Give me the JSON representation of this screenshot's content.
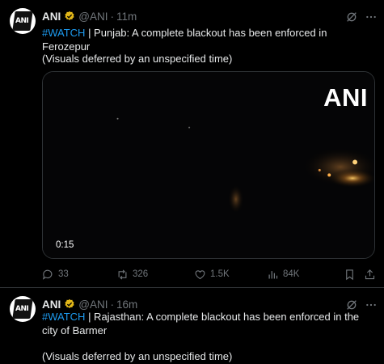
{
  "tweets": [
    {
      "author": "ANI",
      "handle": "@ANI",
      "time": "11m",
      "separator": "·",
      "avatar_text": "ANI",
      "hashtag": "#WATCH",
      "text": " | Punjab: A complete blackout has been enforced in Ferozepur",
      "note": "(Visuals deferred by an unspecified time)",
      "video": {
        "watermark": "ANI",
        "duration": "0:15"
      },
      "stats": {
        "replies": "33",
        "reposts": "326",
        "likes": "1.5K",
        "views": "84K"
      }
    },
    {
      "author": "ANI",
      "handle": "@ANI",
      "time": "16m",
      "separator": "·",
      "avatar_text": "ANI",
      "hashtag": "#WATCH",
      "text": " | Rajasthan: A complete blackout has been enforced in the city of Barmer",
      "note": "(Visuals deferred by an unspecified time)"
    }
  ],
  "icons": {
    "verified": "verified-badge-icon",
    "grok": "grok-icon",
    "more": "more-icon",
    "reply": "reply-icon",
    "repost": "repost-icon",
    "like": "like-icon",
    "views": "views-icon",
    "bookmark": "bookmark-icon",
    "share": "share-icon"
  },
  "colors": {
    "background": "#000000",
    "text": "#e7e9ea",
    "muted": "#71767b",
    "link": "#1d9bf0",
    "border": "#2f3336",
    "verified": "#e2b719"
  }
}
